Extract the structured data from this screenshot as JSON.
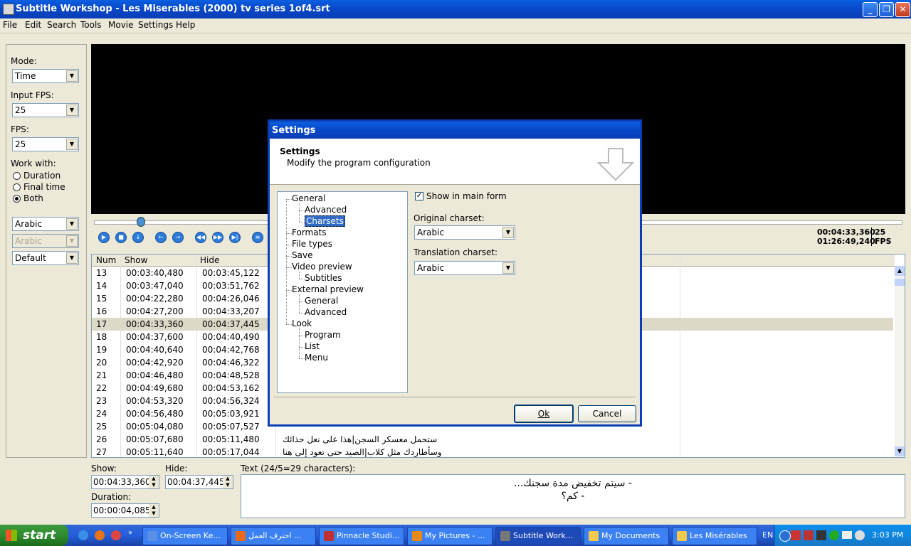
{
  "window": {
    "title": "Subtitle Workshop - Les Miserables (2000) tv series 1of4.srt"
  },
  "menu": [
    "File",
    "Edit",
    "Search",
    "Tools",
    "Movie",
    "Settings",
    "Help"
  ],
  "left_panel": {
    "mode_label": "Mode:",
    "mode_value": "Time",
    "input_fps_label": "Input FPS:",
    "input_fps_value": "25",
    "fps_label": "FPS:",
    "fps_value": "25",
    "work_with_label": "Work with:",
    "work_with_options": [
      "Duration",
      "Final time",
      "Both"
    ],
    "work_with_selected": "Both",
    "charset1": "Arabic",
    "charset2": "Arabic",
    "style": "Default"
  },
  "player": {
    "current_time": "00:04:33,360",
    "total_time": "01:26:49,240",
    "fps_value": "25",
    "fps_unit": "FPS"
  },
  "table": {
    "columns": [
      "Num",
      "Show",
      "Hide"
    ],
    "rows": [
      {
        "num": "13",
        "show": "00:03:40,480",
        "hide": "00:03:45,122",
        "text": ""
      },
      {
        "num": "14",
        "show": "00:03:47,040",
        "hide": "00:03:51,762",
        "text": ""
      },
      {
        "num": "15",
        "show": "00:04:22,280",
        "hide": "00:04:26,046",
        "text": ""
      },
      {
        "num": "16",
        "show": "00:04:27,200",
        "hide": "00:04:33,207",
        "text": ""
      },
      {
        "num": "17",
        "show": "00:04:33,360",
        "hide": "00:04:37,445",
        "text": ""
      },
      {
        "num": "18",
        "show": "00:04:37,600",
        "hide": "00:04:40,490",
        "text": ""
      },
      {
        "num": "19",
        "show": "00:04:40,640",
        "hide": "00:04:42,768",
        "text": ""
      },
      {
        "num": "20",
        "show": "00:04:42,920",
        "hide": "00:04:46,322",
        "text": ""
      },
      {
        "num": "21",
        "show": "00:04:46,480",
        "hide": "00:04:48,528",
        "text": ""
      },
      {
        "num": "22",
        "show": "00:04:49,680",
        "hide": "00:04:53,162",
        "text": ""
      },
      {
        "num": "23",
        "show": "00:04:53,320",
        "hide": "00:04:56,324",
        "text": ""
      },
      {
        "num": "24",
        "show": "00:04:56,480",
        "hide": "00:05:03,921",
        "text": ""
      },
      {
        "num": "25",
        "show": "00:05:04,080",
        "hide": "00:05:07,527",
        "text": ""
      },
      {
        "num": "26",
        "show": "00:05:07,680",
        "hide": "00:05:11,480",
        "text": "ستحمل معسكر السجن|هذا على نعل حذائك"
      },
      {
        "num": "27",
        "show": "00:05:11,640",
        "hide": "00:05:17,044",
        "text": "وسأطاردك مثل كلاب|الصيد حتى تعود إلى هنا"
      }
    ],
    "selected_num": "17"
  },
  "bottom": {
    "show_label": "Show:",
    "show_value": "00:04:33,360",
    "hide_label": "Hide:",
    "hide_value": "00:04:37,445",
    "duration_label": "Duration:",
    "duration_value": "00:00:04,085",
    "text_label": "Text (24/5=29 characters):",
    "text_line1": "- سيتم تخفيض مدة سجنك...",
    "text_line2": "- كم؟"
  },
  "dialog": {
    "title": "Settings",
    "header_title": "Settings",
    "header_subtitle": "Modify the program configuration",
    "tree": [
      {
        "label": "General",
        "level": 0
      },
      {
        "label": "Advanced",
        "level": 1
      },
      {
        "label": "Charsets",
        "level": 1,
        "selected": true
      },
      {
        "label": "Formats",
        "level": 0
      },
      {
        "label": "File types",
        "level": 0
      },
      {
        "label": "Save",
        "level": 0
      },
      {
        "label": "Video preview",
        "level": 0
      },
      {
        "label": "Subtitles",
        "level": 1
      },
      {
        "label": "External preview",
        "level": 0
      },
      {
        "label": "General",
        "level": 1
      },
      {
        "label": "Advanced",
        "level": 1
      },
      {
        "label": "Look",
        "level": 0
      },
      {
        "label": "Program",
        "level": 1
      },
      {
        "label": "List",
        "level": 1
      },
      {
        "label": "Menu",
        "level": 1
      }
    ],
    "show_in_main_form_label": "Show in main form",
    "show_in_main_form_checked": true,
    "original_charset_label": "Original charset:",
    "original_charset_value": "Arabic",
    "translation_charset_label": "Translation charset:",
    "translation_charset_value": "Arabic",
    "ok_label": "Ok",
    "cancel_label": "Cancel"
  },
  "taskbar": {
    "start_label": "start",
    "tasks": [
      {
        "label": "On-Screen Ke...",
        "color": "#5a8fe8"
      },
      {
        "label": "احترف العمل ...",
        "color": "#e86a1a"
      },
      {
        "label": "Pinnacle Studi...",
        "color": "#c03030"
      },
      {
        "label": "My Pictures - ...",
        "color": "#e88a1a"
      },
      {
        "label": "Subtitle Work...",
        "color": "#777777",
        "active": true
      },
      {
        "label": "My Documents",
        "color": "#f2c94c"
      },
      {
        "label": "Les Misérables",
        "color": "#f2c94c"
      }
    ],
    "lang": "EN",
    "clock": "3:03 PM"
  },
  "colors": {
    "xp_blue": "#0846c8",
    "selection": "#316ac5",
    "face": "#ece9d8"
  }
}
